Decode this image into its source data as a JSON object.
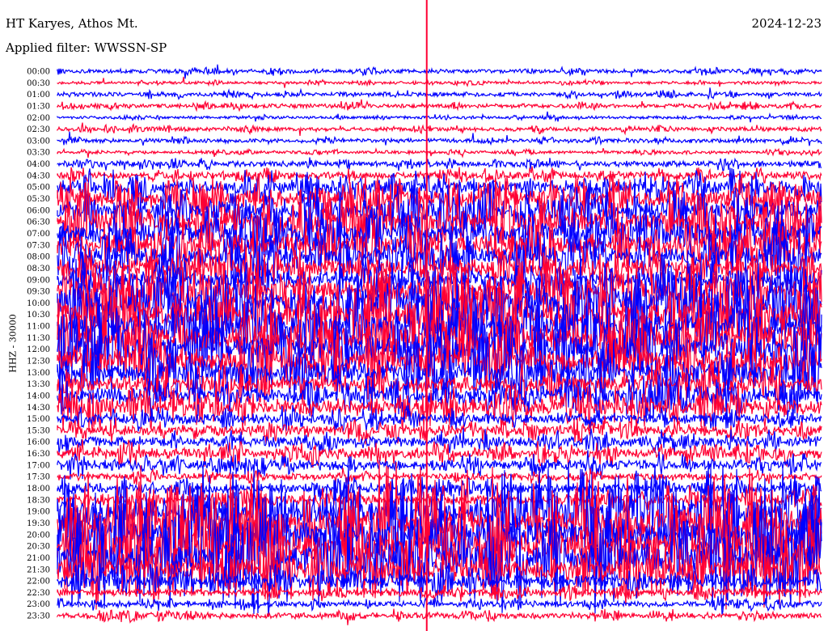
{
  "header": {
    "station": "HT Karyes, Athos Mt.",
    "filter": "Applied filter: WWSSN-SP",
    "date": "2024-12-23"
  },
  "chart_data": {
    "type": "line",
    "title": "HT Karyes, Athos Mt.",
    "subtitle": "Applied filter: WWSSN-SP",
    "ylabel": "HHZ - 30000",
    "colors": [
      "#0000ff",
      "#ff0033"
    ],
    "rows": [
      {
        "t": "00:00",
        "a": 1
      },
      {
        "t": "00:30",
        "a": 0.6
      },
      {
        "t": "01:00",
        "a": 1
      },
      {
        "t": "01:30",
        "a": 1
      },
      {
        "t": "02:00",
        "a": 0.6
      },
      {
        "t": "02:30",
        "a": 1
      },
      {
        "t": "03:00",
        "a": 1
      },
      {
        "t": "03:30",
        "a": 0.7
      },
      {
        "t": "04:00",
        "a": 1.5
      },
      {
        "t": "04:30",
        "a": 2
      },
      {
        "t": "05:00",
        "a": 4
      },
      {
        "t": "05:30",
        "a": 5
      },
      {
        "t": "06:00",
        "a": 6
      },
      {
        "t": "06:30",
        "a": 7
      },
      {
        "t": "07:00",
        "a": 6
      },
      {
        "t": "07:30",
        "a": 6
      },
      {
        "t": "08:00",
        "a": 6
      },
      {
        "t": "08:30",
        "a": 5
      },
      {
        "t": "09:00",
        "a": 5
      },
      {
        "t": "09:30",
        "a": 7
      },
      {
        "t": "10:00",
        "a": 8
      },
      {
        "t": "10:30",
        "a": 8
      },
      {
        "t": "11:00",
        "a": 8
      },
      {
        "t": "11:30",
        "a": 8
      },
      {
        "t": "12:00",
        "a": 8
      },
      {
        "t": "12:30",
        "a": 7
      },
      {
        "t": "13:00",
        "a": 7
      },
      {
        "t": "13:30",
        "a": 5
      },
      {
        "t": "14:00",
        "a": 5
      },
      {
        "t": "14:30",
        "a": 5
      },
      {
        "t": "15:00",
        "a": 3
      },
      {
        "t": "15:30",
        "a": 3
      },
      {
        "t": "16:00",
        "a": 3
      },
      {
        "t": "16:30",
        "a": 3
      },
      {
        "t": "17:00",
        "a": 3
      },
      {
        "t": "17:30",
        "a": 2
      },
      {
        "t": "18:00",
        "a": 3
      },
      {
        "t": "18:30",
        "a": 3
      },
      {
        "t": "19:00",
        "a": 8
      },
      {
        "t": "19:30",
        "a": 9
      },
      {
        "t": "20:00",
        "a": 9
      },
      {
        "t": "20:30",
        "a": 9
      },
      {
        "t": "21:00",
        "a": 9
      },
      {
        "t": "21:30",
        "a": 7
      },
      {
        "t": "22:00",
        "a": 4
      },
      {
        "t": "22:30",
        "a": 2
      },
      {
        "t": "23:00",
        "a": 1.5
      },
      {
        "t": "23:30",
        "a": 1.5
      }
    ],
    "minutes_per_line": 30,
    "event_minute": 14.5
  }
}
